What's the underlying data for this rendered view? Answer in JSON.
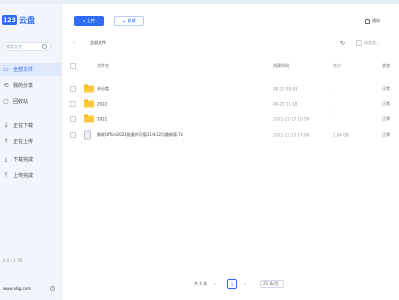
{
  "brand": {
    "badge": "123",
    "name": "云盘"
  },
  "sidebar": {
    "search_placeholder": "搜索文件",
    "items": [
      {
        "label": "全部文件",
        "icon": "folder-icon",
        "active": true
      },
      {
        "label": "我的分享",
        "icon": "share-icon"
      },
      {
        "label": "回收站",
        "icon": "trash-icon"
      },
      {
        "label": "正在下载",
        "icon": "download-icon"
      },
      {
        "label": "正在上传",
        "icon": "upload-icon"
      },
      {
        "label": "下载完成",
        "icon": "download-done-icon"
      },
      {
        "label": "上传完成",
        "icon": "upload-done-icon"
      }
    ],
    "storage_text": "0.0 / 2 TB",
    "site_url": "www.x6g.com"
  },
  "toolbar": {
    "upload_label": "上传",
    "new_label": "新建",
    "notice_label": "通知"
  },
  "pathbar": {
    "crumb": "全部文件",
    "dimension_label": "按维度..."
  },
  "table": {
    "headers": {
      "name": "文件名",
      "date": "创建时间",
      "size": "大小",
      "status": "状态"
    },
    "rows": [
      {
        "type": "folder",
        "name": "未分类",
        "date": "08-22 09:43",
        "size": "-",
        "status": "正常"
      },
      {
        "type": "folder",
        "name": "2022",
        "date": "08-20 11:18",
        "size": "-",
        "status": "正常"
      },
      {
        "type": "folder",
        "name": "2021",
        "date": "2021-11-17 10:59",
        "size": "-",
        "status": "正常"
      },
      {
        "type": "file",
        "name": "微软Office2021批量许可版21年12月最新版.7z",
        "date": "2021-12-15 17:08",
        "size": "1.84 GB",
        "status": "正常"
      }
    ]
  },
  "pager": {
    "total": "共 4 条",
    "current": "1",
    "page_size": "25 条/页"
  },
  "colors": {
    "accent": "#2f6cf2",
    "folder": "#ffc83d"
  }
}
